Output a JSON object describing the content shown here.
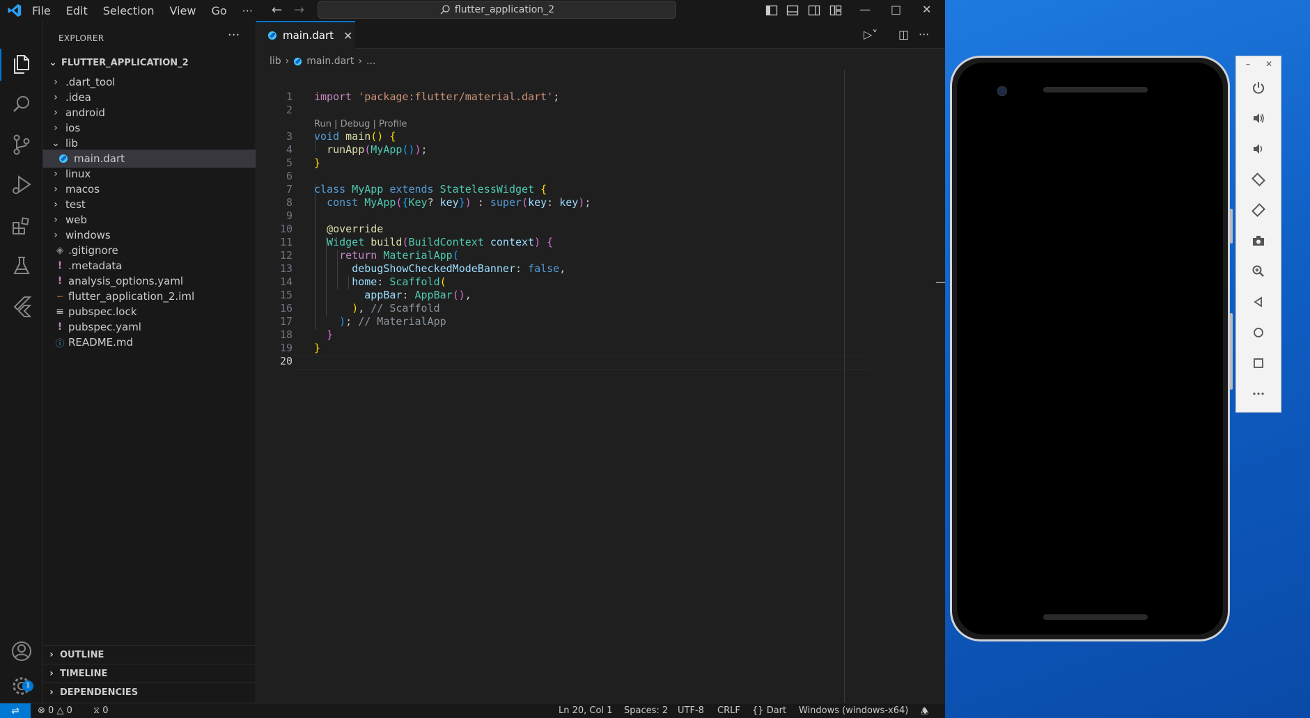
{
  "titlebar": {
    "menu": [
      "File",
      "Edit",
      "Selection",
      "View",
      "Go",
      "···"
    ],
    "search_text": "flutter_application_2"
  },
  "sidebar": {
    "title": "EXPLORER",
    "more": "···",
    "project": "FLUTTER_APPLICATION_2",
    "items": [
      {
        "label": ".dart_tool",
        "type": "folder",
        "icon": "chevron-right-icon"
      },
      {
        "label": ".idea",
        "type": "folder",
        "icon": "chevron-right-icon"
      },
      {
        "label": "android",
        "type": "folder",
        "icon": "chevron-right-icon"
      },
      {
        "label": "ios",
        "type": "folder",
        "icon": "chevron-right-icon"
      },
      {
        "label": "lib",
        "type": "folder-open",
        "icon": "chevron-down-icon"
      },
      {
        "label": "main.dart",
        "type": "dart-file",
        "icon": "dart-icon"
      },
      {
        "label": "linux",
        "type": "folder",
        "icon": "chevron-right-icon"
      },
      {
        "label": "macos",
        "type": "folder",
        "icon": "chevron-right-icon"
      },
      {
        "label": "test",
        "type": "folder",
        "icon": "chevron-right-icon"
      },
      {
        "label": "web",
        "type": "folder",
        "icon": "chevron-right-icon"
      },
      {
        "label": "windows",
        "type": "folder",
        "icon": "chevron-right-icon"
      },
      {
        "label": ".gitignore",
        "type": "file",
        "icon": "git-icon"
      },
      {
        "label": ".metadata",
        "type": "file",
        "icon": "exclamation-icon"
      },
      {
        "label": "analysis_options.yaml",
        "type": "file",
        "icon": "exclamation-icon"
      },
      {
        "label": "flutter_application_2.iml",
        "type": "file",
        "icon": "rss-icon"
      },
      {
        "label": "pubspec.lock",
        "type": "file",
        "icon": "lines-icon"
      },
      {
        "label": "pubspec.yaml",
        "type": "file",
        "icon": "exclamation-icon"
      },
      {
        "label": "README.md",
        "type": "file",
        "icon": "info-icon"
      }
    ],
    "panels": [
      "OUTLINE",
      "TIMELINE",
      "DEPENDENCIES"
    ]
  },
  "editor": {
    "tab_label": "main.dart",
    "breadcrumb": [
      "lib",
      "main.dart",
      "..."
    ],
    "codelens": "Run | Debug | Profile",
    "line_numbers": [
      "1",
      "2",
      "3",
      "4",
      "5",
      "6",
      "7",
      "8",
      "9",
      "10",
      "11",
      "12",
      "13",
      "14",
      "15",
      "16",
      "17",
      "18",
      "19",
      "20"
    ],
    "current_line": "20"
  },
  "statusbar": {
    "errors": "0",
    "warnings": "0",
    "ports": "0",
    "position": "Ln 20, Col 1",
    "spaces": "Spaces: 2",
    "encoding": "UTF-8",
    "eol": "CRLF",
    "language": "Dart",
    "device": "Windows (windows-x64)"
  },
  "activity": {
    "settings_badge": "1"
  },
  "colors": {
    "accent": "#0078d4",
    "keyword": "#569cd6",
    "control": "#c586c0",
    "string": "#ce9178",
    "function": "#dcdcaa",
    "class": "#4ec9b0",
    "variable": "#9cdcfe"
  }
}
